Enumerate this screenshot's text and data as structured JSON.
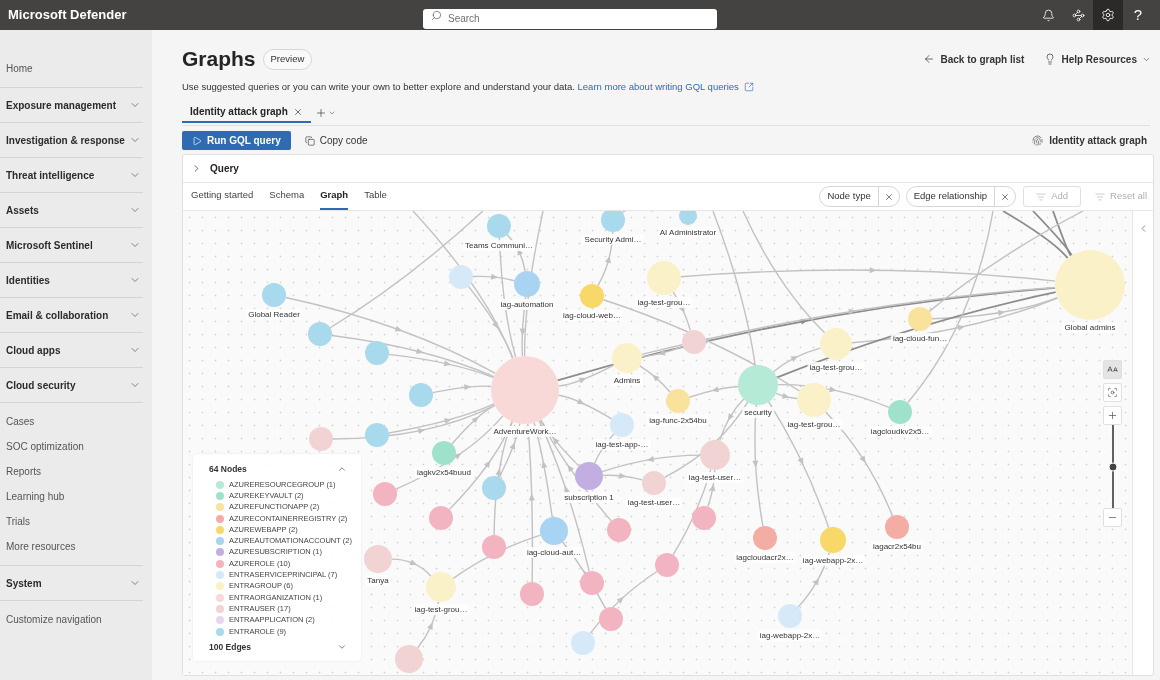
{
  "top_bar": {
    "title": "Microsoft Defender",
    "search": {
      "placeholder": "Search"
    },
    "icons": [
      {
        "kind": "notifications",
        "selected": false
      },
      {
        "kind": "connections",
        "selected": false
      },
      {
        "kind": "settings",
        "selected": true
      },
      {
        "kind": "help",
        "glyph": "?",
        "selected": false
      }
    ]
  },
  "sidebar": {
    "items": [
      {
        "label": "Home",
        "kind": "link"
      },
      {
        "label": "Exposure management",
        "kind": "section"
      },
      {
        "label": "Investigation & response",
        "kind": "section"
      },
      {
        "label": "Threat intelligence",
        "kind": "section"
      },
      {
        "label": "Assets",
        "kind": "section"
      },
      {
        "label": "Microsoft Sentinel",
        "kind": "section"
      },
      {
        "label": "Identities",
        "kind": "section"
      },
      {
        "label": "Email & collaboration",
        "kind": "section"
      },
      {
        "label": "Cloud apps",
        "kind": "section"
      },
      {
        "label": "Cloud security",
        "kind": "section"
      },
      {
        "label": "Cases",
        "kind": "link"
      },
      {
        "label": "SOC optimization",
        "kind": "link"
      },
      {
        "label": "Reports",
        "kind": "link"
      },
      {
        "label": "Learning hub",
        "kind": "link"
      },
      {
        "label": "Trials",
        "kind": "link"
      },
      {
        "label": "More resources",
        "kind": "link"
      },
      {
        "label": "System",
        "kind": "section"
      },
      {
        "label": "Customize navigation",
        "kind": "link"
      }
    ]
  },
  "header": {
    "title": "Graphs",
    "badge": "Preview",
    "description": "Use suggested queries or you can write your own to better explore and understand your data.",
    "link": "Learn more about writing GQL queries",
    "actions": [
      {
        "label": "Back to graph list",
        "kind": "back"
      },
      {
        "label": "Help Resources",
        "kind": "menu"
      }
    ]
  },
  "query_tabs": [
    {
      "label": "Identity attack graph",
      "selected": true
    }
  ],
  "toolbar": {
    "run_button": "Run GQL query",
    "copy_button": "Copy code",
    "graph_type": "Identity attack graph"
  },
  "query_panel": {
    "title": "Query",
    "expanded": false
  },
  "view_tabs": [
    {
      "label": "Getting started",
      "selected": false
    },
    {
      "label": "Schema",
      "selected": false
    },
    {
      "label": "Graph",
      "selected": true
    },
    {
      "label": "Table",
      "selected": false
    }
  ],
  "filters": {
    "chips": [
      {
        "label": "Node type"
      },
      {
        "label": "Edge relationship"
      }
    ],
    "add": {
      "label": "Add",
      "disabled": true
    },
    "reset": {
      "label": "Reset all",
      "disabled": true
    }
  },
  "graph": {
    "nodes": [
      {
        "label": "Teams Communi…",
        "color": "#a8d9ec"
      },
      {
        "label": "Security Admi…",
        "color": "#a8d9ec"
      },
      {
        "label": "AI Administrator",
        "color": "#a8d9ec"
      },
      {
        "color": "#d5e9f8"
      },
      {
        "label": "iag-automation",
        "color": "#a9d3f2"
      },
      {
        "label": "iag-cloud-web…",
        "color": "#f8d868"
      },
      {
        "label": "iag-test-grou…",
        "color": "#fbf1c8"
      },
      {
        "label": "Global Reader",
        "color": "#a8d9ec"
      },
      {
        "color": "#a8d9ec"
      },
      {
        "color": "#a8d9ec"
      },
      {
        "color": "#a8d9ec"
      },
      {
        "color": "#a8d9ec"
      },
      {
        "label": "AdventureWork…",
        "color": "#f9d9d7"
      },
      {
        "label": "Admins",
        "color": "#fbf1c8"
      },
      {
        "color": "#f2d3d3"
      },
      {
        "label": "iag-func-2x54bu",
        "color": "#f9e39c"
      },
      {
        "label": "iag-test-app-…",
        "color": "#d5e9f8"
      },
      {
        "label": "security",
        "color": "#b4ead6"
      },
      {
        "label": "iag-test-grou…",
        "color": "#fbf1c8"
      },
      {
        "label": "iag-test-grou…",
        "color": "#fbf1c8"
      },
      {
        "label": "iag-cloud-fun…",
        "color": "#f9e39c"
      },
      {
        "label": "iagcloudkv2x5…",
        "color": "#9fe2cc"
      },
      {
        "label": "Global admins",
        "color": "#fbf1c8"
      },
      {
        "label": "iagkv2x54buud",
        "color": "#9fe2cc"
      },
      {
        "color": "#f2d3d3"
      },
      {
        "color": "#f3b4c1"
      },
      {
        "color": "#f3b4c1"
      },
      {
        "color": "#a8d9ec"
      },
      {
        "label": "subscription 1",
        "color": "#c3aee2"
      },
      {
        "label": "iag-test-user…",
        "color": "#f2d3d3"
      },
      {
        "label": "iag-test-user…",
        "color": "#f2d3d3"
      },
      {
        "color": "#f3b4c1"
      },
      {
        "label": "iag-cloud-aut…",
        "color": "#a9d3f2"
      },
      {
        "color": "#f3b4c1"
      },
      {
        "color": "#f3b4c1"
      },
      {
        "color": "#f3b4c1"
      },
      {
        "color": "#f3b4c1"
      },
      {
        "color": "#f3b4c1"
      },
      {
        "label": "iag-test-grou…",
        "color": "#fbf1c8"
      },
      {
        "color": "#f3b4c1"
      },
      {
        "color": "#d5e9f8"
      },
      {
        "color": "#f2d3d3"
      },
      {
        "label": "iagcloudacr2x…",
        "color": "#f4ada5"
      },
      {
        "label": "iag-webapp-2x…",
        "color": "#f8d868"
      },
      {
        "label": "iagacr2x54bu",
        "color": "#f4ada5"
      },
      {
        "label": "iag-webapp-2x…",
        "color": "#d5e9f8"
      },
      {
        "label": "Tanya",
        "color": "#f2d3d3"
      }
    ],
    "zoom": {
      "labels_on": true,
      "level": 0.5
    },
    "legend": {
      "nodes": {
        "label": "64 Nodes",
        "expanded": true
      },
      "types": [
        {
          "label": "AZURERESOURCEGROUP (1)",
          "color": "#b4ead6"
        },
        {
          "label": "AZUREKEYVAULT (2)",
          "color": "#9fe2cc"
        },
        {
          "label": "AZUREFUNCTIONAPP (2)",
          "color": "#f9e39c"
        },
        {
          "label": "AZURECONTAINERREGISTRY (2)",
          "color": "#f4ada5"
        },
        {
          "label": "AZUREWEBAPP (2)",
          "color": "#f8d868"
        },
        {
          "label": "AZUREAUTOMATIONACCOUNT (2)",
          "color": "#a9d3f2"
        },
        {
          "label": "AZURESUBSCRIPTION (1)",
          "color": "#c3aee2"
        },
        {
          "label": "AZUREROLE (10)",
          "color": "#f3b4c1"
        },
        {
          "label": "ENTRASERVICEPRINCIPAL (7)",
          "color": "#d5e9f8"
        },
        {
          "label": "ENTRAGROUP (6)",
          "color": "#fbf1c8"
        },
        {
          "label": "ENTRAORGANIZATION (1)",
          "color": "#f9d9d7"
        },
        {
          "label": "ENTRAUSER (17)",
          "color": "#f2d3d3"
        },
        {
          "label": "ENTRAAPPLICATION (2)",
          "color": "#e5d7f0"
        },
        {
          "label": "ENTRAROLE (9)",
          "color": "#a8d9ec"
        }
      ],
      "edges": {
        "label": "100 Edges",
        "expanded": false
      }
    }
  }
}
